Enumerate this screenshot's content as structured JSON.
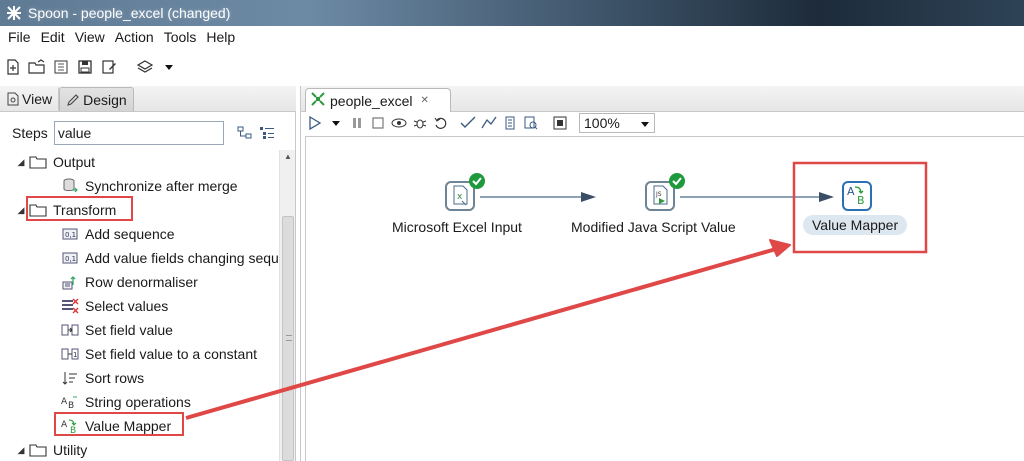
{
  "window": {
    "title": "Spoon - people_excel (changed)",
    "icon": "spoon-app-icon"
  },
  "menu": {
    "items": [
      "File",
      "Edit",
      "View",
      "Action",
      "Tools",
      "Help"
    ]
  },
  "toolbar": {
    "icons": [
      "new-file-icon",
      "open-folder-icon",
      "explore-repository-icon",
      "save-icon",
      "save-as-icon",
      "layers-icon",
      "dropdown-arrow-icon"
    ]
  },
  "left_panel": {
    "tabs": [
      {
        "label": "View",
        "icon": "view-icon"
      },
      {
        "label": "Design",
        "icon": "design-pencil-icon",
        "active": true
      }
    ],
    "steps_label": "Steps",
    "search_value": "value",
    "tree": [
      {
        "label": "Output",
        "type": "folder",
        "expanded": true
      },
      {
        "label": "Synchronize after merge",
        "type": "step",
        "icon": "database-sync-icon"
      },
      {
        "label": "Transform",
        "type": "folder",
        "expanded": true,
        "highlighted": true
      },
      {
        "label": "Add sequence",
        "type": "step",
        "icon": "add-sequence-icon"
      },
      {
        "label": "Add value fields changing sequence",
        "type": "step",
        "icon": "add-value-fields-icon"
      },
      {
        "label": "Row denormaliser",
        "type": "step",
        "icon": "row-denormaliser-icon"
      },
      {
        "label": "Select values",
        "type": "step",
        "icon": "select-values-icon"
      },
      {
        "label": "Set field value",
        "type": "step",
        "icon": "set-field-value-icon"
      },
      {
        "label": "Set field value to a constant",
        "type": "step",
        "icon": "set-field-constant-icon"
      },
      {
        "label": "Sort rows",
        "type": "step",
        "icon": "sort-rows-icon"
      },
      {
        "label": "String operations",
        "type": "step",
        "icon": "string-operations-icon"
      },
      {
        "label": "Value Mapper",
        "type": "step",
        "icon": "value-mapper-icon",
        "highlighted": true
      },
      {
        "label": "Utility",
        "type": "folder",
        "expanded": true
      }
    ]
  },
  "editor": {
    "tab_title": "people_excel",
    "zoom": "100%",
    "steps": [
      {
        "label": "Microsoft Excel Input",
        "icon": "excel-input-icon",
        "status": "ok"
      },
      {
        "label": "Modified Java Script Value",
        "icon": "javascript-icon",
        "status": "ok"
      },
      {
        "label": "Value Mapper",
        "icon": "value-mapper-icon",
        "selected": true
      }
    ]
  },
  "colors": {
    "annotation_red": "#e04848",
    "hop_line": "#4a6b8a",
    "ok_green": "#1e9a3c",
    "selected_label_bg": "#dde7f0"
  }
}
